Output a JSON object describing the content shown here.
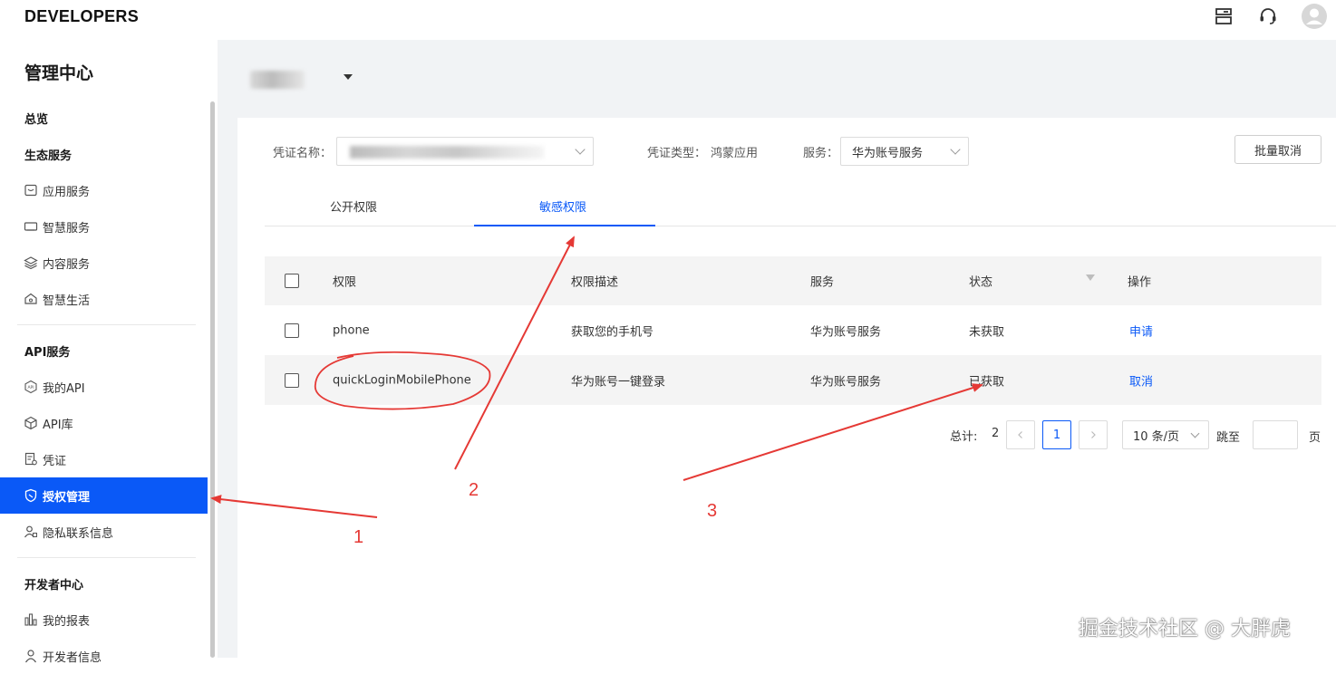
{
  "topbar": {
    "brand": "DEVELOPERS"
  },
  "sidebar": {
    "title": "管理中心",
    "overview": "总览",
    "section_eco": "生态服务",
    "eco_items": [
      "应用服务",
      "智慧服务",
      "内容服务",
      "智慧生活"
    ],
    "section_api": "API服务",
    "api_items": [
      "我的API",
      "API库",
      "凭证",
      "授权管理",
      "隐私联系信息"
    ],
    "section_dev": "开发者中心",
    "dev_items": [
      "我的报表",
      "开发者信息"
    ]
  },
  "filters": {
    "credential_name_label": "凭证名称：",
    "credential_type_label": "凭证类型：",
    "credential_type_value": "鸿蒙应用",
    "service_label": "服务：",
    "service_value": "华为账号服务",
    "batch_cancel": "批量取消"
  },
  "tabs": [
    "公开权限",
    "敏感权限"
  ],
  "table": {
    "headers": [
      "权限",
      "权限描述",
      "服务",
      "状态",
      "操作"
    ],
    "rows": [
      {
        "permission": "phone",
        "description": "获取您的手机号",
        "service": "华为账号服务",
        "status": "未获取",
        "action": "申请"
      },
      {
        "permission": "quickLoginMobilePhone",
        "description": "华为账号一键登录",
        "service": "华为账号服务",
        "status": "已获取",
        "action": "取消"
      }
    ]
  },
  "pagination": {
    "total_label": "总计:",
    "total": "2",
    "current_page": "1",
    "page_size": "10 条/页",
    "jump_label": "跳至",
    "page_unit": "页"
  },
  "annotations": [
    "1",
    "2",
    "3"
  ],
  "watermark": "掘金技术社区 @ 大胖虎",
  "colors": {
    "accent": "#0a59f7",
    "annotation": "#e53935"
  }
}
